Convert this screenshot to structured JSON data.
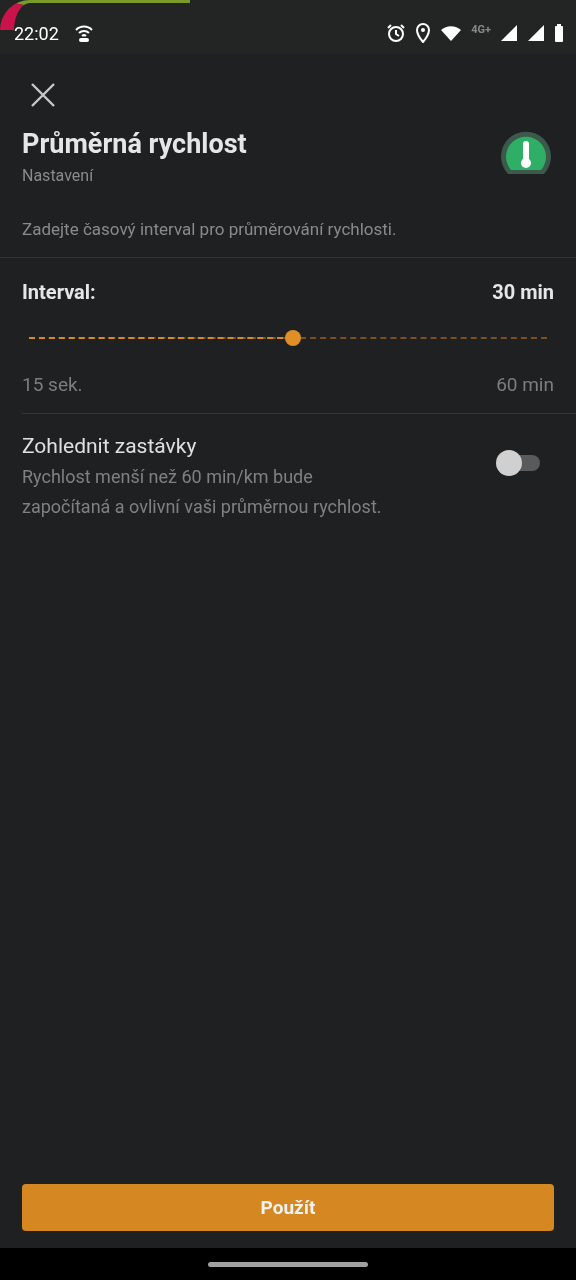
{
  "status_bar": {
    "time": "22:02",
    "network_label": "4G+"
  },
  "header": {
    "title": "Průměrná rychlost",
    "subtitle": "Nastavení"
  },
  "description": "Zadejte časový interval pro průměrování rychlosti.",
  "interval": {
    "label": "Interval:",
    "value": "30 min",
    "level": 0.51,
    "min_label": "15 sek.",
    "max_label": "60 min"
  },
  "stops_setting": {
    "title": "Zohlednit zastávky",
    "description": "Rychlost menší než 60 min/km bude započítaná a ovlivní vaši průměrnou rychlost.",
    "on": false
  },
  "apply_button": "Použít"
}
